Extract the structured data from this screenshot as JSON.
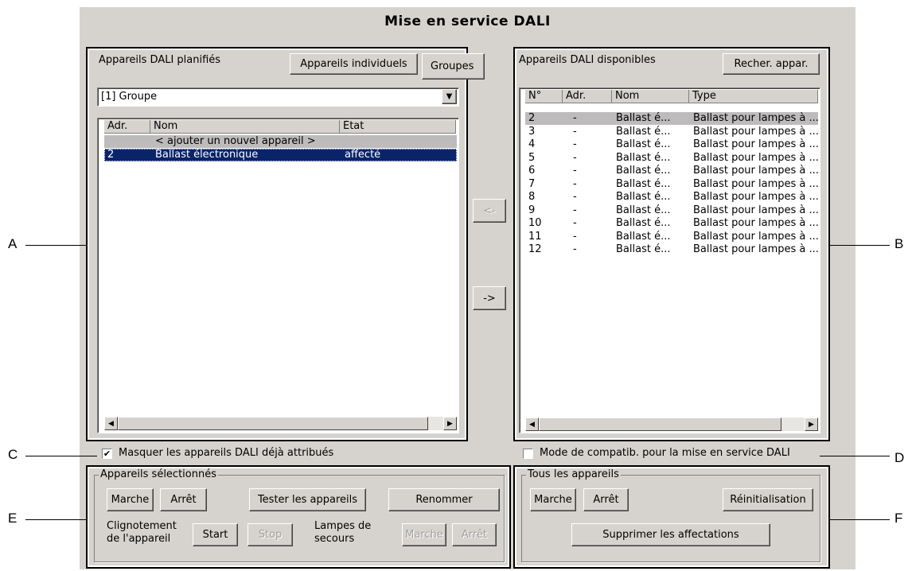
{
  "window": {
    "title": "Mise en service DALI"
  },
  "planned": {
    "label": "Appareils DALI planifiés",
    "tab_individual": "Appareils individuels",
    "tab_groups": "Groupes",
    "group_select": "[1] Groupe",
    "columns": [
      "Adr.",
      "Nom",
      "État"
    ],
    "add_row": "< ajouter un nouvel appareil >",
    "rows": [
      {
        "adr": "2",
        "nom": "Ballast électronique",
        "etat": "affecté"
      }
    ]
  },
  "arrows": {
    "left": "<-",
    "right": "->"
  },
  "available": {
    "label": "Appareils DALI disponibles",
    "search_button": "Recher. appar.",
    "columns": [
      "N°",
      "Adr.",
      "Nom",
      "Type"
    ],
    "rows": [
      {
        "n": "2",
        "adr": "-",
        "nom": "Ballast é...",
        "type": "Ballast pour lampes à ..."
      },
      {
        "n": "3",
        "adr": "-",
        "nom": "Ballast é...",
        "type": "Ballast pour lampes à ..."
      },
      {
        "n": "4",
        "adr": "-",
        "nom": "Ballast é...",
        "type": "Ballast pour lampes à ..."
      },
      {
        "n": "5",
        "adr": "-",
        "nom": "Ballast é...",
        "type": "Ballast pour lampes à ..."
      },
      {
        "n": "6",
        "adr": "-",
        "nom": "Ballast é...",
        "type": "Ballast pour lampes à ..."
      },
      {
        "n": "7",
        "adr": "-",
        "nom": "Ballast é...",
        "type": "Ballast pour lampes à ..."
      },
      {
        "n": "8",
        "adr": "-",
        "nom": "Ballast é...",
        "type": "Ballast pour lampes à ..."
      },
      {
        "n": "9",
        "adr": "-",
        "nom": "Ballast é...",
        "type": "Ballast pour lampes à ..."
      },
      {
        "n": "10",
        "adr": "-",
        "nom": "Ballast é...",
        "type": "Ballast pour lampes à ..."
      },
      {
        "n": "11",
        "adr": "-",
        "nom": "Ballast é...",
        "type": "Ballast pour lampes à ..."
      },
      {
        "n": "12",
        "adr": "-",
        "nom": "Ballast é...",
        "type": "Ballast pour lampes à ..."
      }
    ]
  },
  "hide_assigned": {
    "label": "Masquer les appareils DALI déjà attribués",
    "checked": true
  },
  "compat_mode": {
    "label": "Mode de compatib. pour la mise en service DALI",
    "checked": false
  },
  "selected": {
    "title": "Appareils sélectionnés",
    "on": "Marche",
    "off": "Arrêt",
    "test": "Tester les appareils",
    "rename": "Renommer",
    "blink_label_1": "Clignotement",
    "blink_label_2": "de l'appareil",
    "start": "Start",
    "stop": "Stop",
    "emergency_label_1": "Lampes de",
    "emergency_label_2": "secours",
    "em_on": "Marche",
    "em_off": "Arrêt"
  },
  "all": {
    "title": "Tous les appareils",
    "on": "Marche",
    "off": "Arrêt",
    "reset": "Réinitialisation",
    "delete": "Supprimer les affectations"
  },
  "callouts": {
    "a": "A",
    "b": "B",
    "c": "C",
    "d": "D",
    "e": "E",
    "f": "F"
  }
}
